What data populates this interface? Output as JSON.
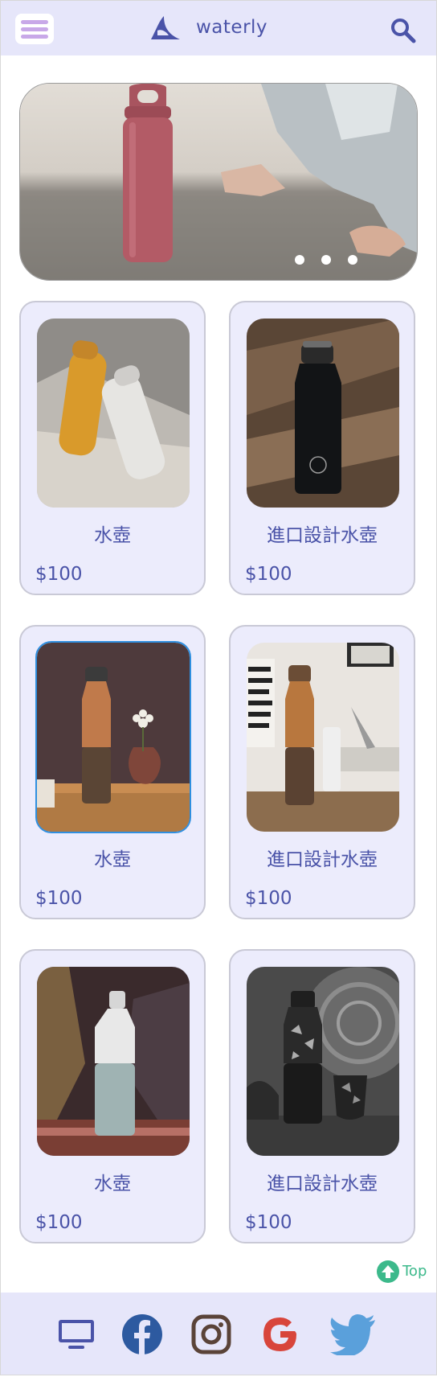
{
  "brand": {
    "name": "waterly",
    "logo_color": "#4a53a8"
  },
  "header": {
    "menu_icon": "hamburger-menu-icon",
    "search_icon": "search-icon"
  },
  "carousel": {
    "slide_count": 3,
    "active_index": 0
  },
  "products": [
    {
      "name": "水壺",
      "price": "$100"
    },
    {
      "name": "進口設計水壺",
      "price": "$100"
    },
    {
      "name": "水壺",
      "price": "$100"
    },
    {
      "name": "進口設計水壺",
      "price": "$100"
    },
    {
      "name": "水壺",
      "price": "$100"
    },
    {
      "name": "進口設計水壺",
      "price": "$100"
    }
  ],
  "back_to_top": {
    "label": "Top",
    "icon": "arrow-up-circle-icon"
  },
  "footer": {
    "icons": [
      "monitor-icon",
      "facebook-icon",
      "instagram-icon",
      "google-icon",
      "twitter-icon"
    ]
  },
  "colors": {
    "accent": "#4a53a8",
    "background_tint": "#e6e6fa",
    "card_bg": "#ececfc",
    "top_green": "#3cb98b"
  }
}
